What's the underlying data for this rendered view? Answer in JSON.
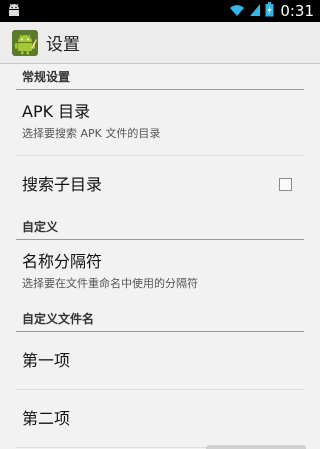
{
  "status_bar": {
    "time": "0:31",
    "icons": [
      "android-notification-icon",
      "wifi-icon",
      "signal-icon",
      "battery-icon"
    ]
  },
  "action_bar": {
    "title": "设置",
    "icon": "android-robot-icon"
  },
  "sections": [
    {
      "header": "常规设置",
      "items": [
        {
          "title": "APK 目录",
          "summary": "选择要搜索 APK 文件的目录"
        },
        {
          "title": "搜索子目录",
          "checked": false
        }
      ]
    },
    {
      "header": "自定义",
      "items": [
        {
          "title": "名称分隔符",
          "summary": "选择要在文件重命名中使用的分隔符"
        }
      ]
    },
    {
      "header": "自定义文件名",
      "items": [
        {
          "title": "第一项"
        },
        {
          "title": "第二项"
        }
      ]
    }
  ]
}
